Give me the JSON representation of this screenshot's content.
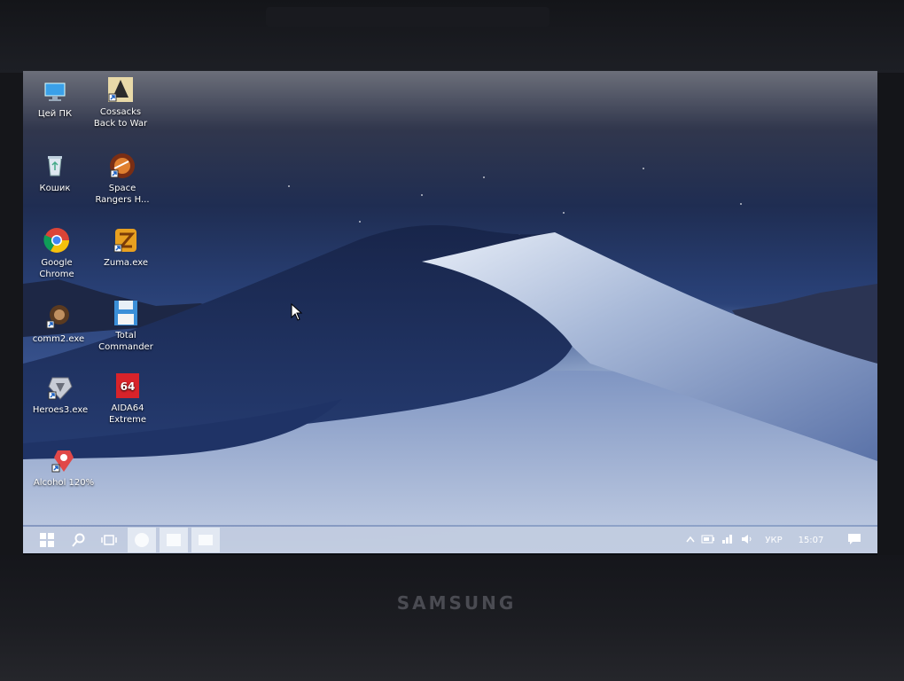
{
  "device": {
    "brand": "SAMSUNG"
  },
  "desktop": {
    "icons": [
      {
        "id": "this-pc",
        "label": "Цей ПК",
        "icon": "monitor-icon"
      },
      {
        "id": "cossacks",
        "label": "Cossacks Back to War",
        "icon": "cossacks-icon"
      },
      {
        "id": "recycle-bin",
        "label": "Кошик",
        "icon": "recycle-bin-icon"
      },
      {
        "id": "space-rangers",
        "label": "Space Rangers H...",
        "icon": "space-rangers-icon"
      },
      {
        "id": "google-chrome",
        "label": "Google Chrome",
        "icon": "chrome-icon"
      },
      {
        "id": "zuma",
        "label": "Zuma.exe",
        "icon": "zuma-icon"
      },
      {
        "id": "comm2",
        "label": "comm2.exe",
        "icon": "comm2-icon"
      },
      {
        "id": "total-commander",
        "label": "Total Commander",
        "icon": "floppy-icon"
      },
      {
        "id": "heroes3",
        "label": "Heroes3.exe",
        "icon": "heroes-icon"
      },
      {
        "id": "aida64",
        "label": "AIDA64 Extreme",
        "icon": "aida64-icon"
      },
      {
        "id": "alcohol",
        "label": "Alcohol 120%",
        "icon": "alcohol-icon"
      }
    ]
  },
  "taskbar": {
    "start_icon": "windows-logo-icon",
    "search_icon": "search-icon",
    "taskview_icon": "task-view-icon",
    "pinned": [
      "pinned-app-1",
      "pinned-app-2",
      "pinned-app-3"
    ],
    "tray": {
      "language": "УКР",
      "time": "15:07"
    }
  }
}
